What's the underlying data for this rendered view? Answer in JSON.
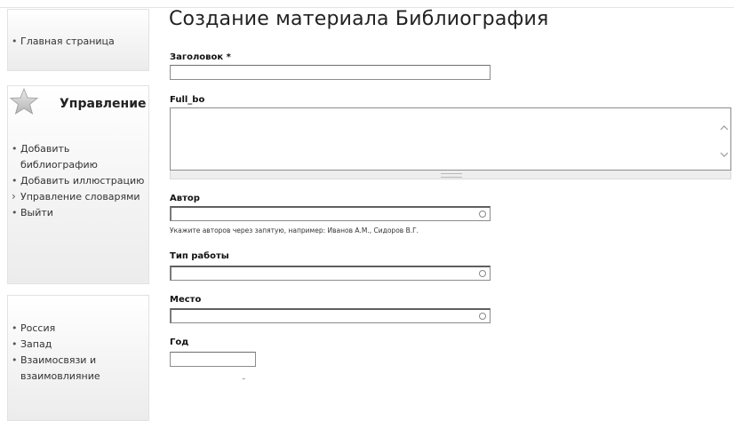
{
  "page": {
    "title": "Создание материала Библиография"
  },
  "sidebar": {
    "navigation": {
      "items": [
        {
          "label": "Главная страница"
        }
      ]
    },
    "admin": {
      "title": "Управление",
      "items": [
        {
          "label": "Добавить библиографию"
        },
        {
          "label": "Добавить иллюстрацию"
        },
        {
          "label": "Управление словарями",
          "expandable": true
        },
        {
          "label": "Выйти"
        }
      ]
    },
    "regions": {
      "items": [
        {
          "label": "Россия"
        },
        {
          "label": "Запад"
        },
        {
          "label": "Взаимосвязи и взаимовлияние"
        }
      ]
    }
  },
  "form": {
    "title_field": {
      "label": "Заголовок *",
      "value": ""
    },
    "full_bo": {
      "label": "Full_bo",
      "value": ""
    },
    "author": {
      "label": "Автор",
      "value": "",
      "description": "Укажите авторов через запятую, например: Иванов А.М., Сидоров В.Г."
    },
    "work_type": {
      "label": "Тип работы",
      "value": ""
    },
    "place": {
      "label": "Место",
      "value": ""
    },
    "year": {
      "label": "Год",
      "value": ""
    }
  },
  "bullets": {
    "dot": "•",
    "arrow": "›"
  },
  "colors": {
    "sidebar_bg": "#f2f2f2",
    "border": "#8c8c8c",
    "text": "#222222"
  }
}
